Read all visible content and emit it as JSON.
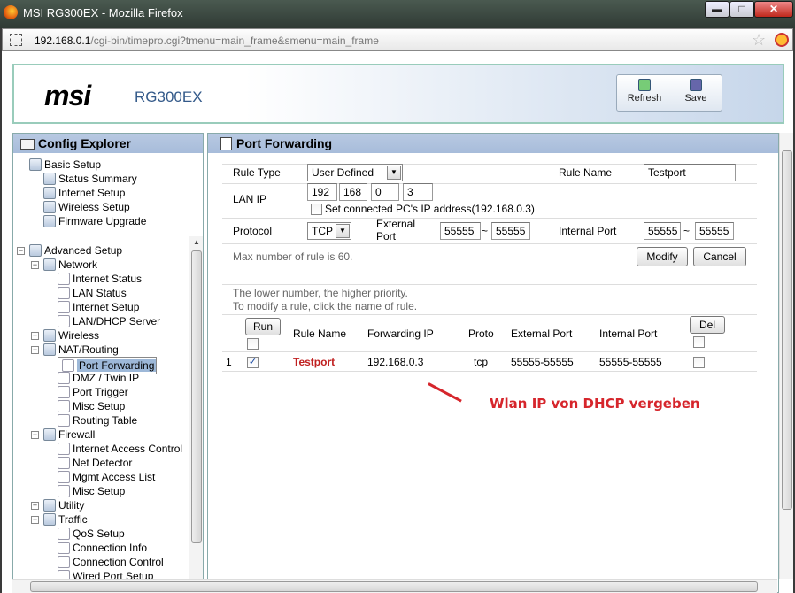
{
  "window": {
    "title": "MSI RG300EX - Mozilla Firefox",
    "min": "▬",
    "max": "□",
    "close": "✕"
  },
  "urlbar": {
    "host": "192.168.0.1",
    "path": "/cgi-bin/timepro.cgi?tmenu=main_frame&smenu=main_frame"
  },
  "header": {
    "logo": "msi",
    "model": "RG300EX",
    "refresh": "Refresh",
    "save": "Save"
  },
  "explorer": {
    "title": "Config Explorer",
    "basic": "Basic Setup",
    "status_summary": "Status Summary",
    "internet_setup": "Internet Setup",
    "wireless_setup": "Wireless Setup",
    "firmware_upgrade": "Firmware Upgrade",
    "advanced": "Advanced Setup",
    "network": "Network",
    "internet_status": "Internet Status",
    "lan_status": "LAN Status",
    "net_internet_setup": "Internet Setup",
    "lan_dhcp": "LAN/DHCP Server",
    "wireless": "Wireless",
    "nat": "NAT/Routing",
    "port_forwarding": "Port Forwarding",
    "dmz": "DMZ / Twin IP",
    "port_trigger": "Port Trigger",
    "misc_setup": "Misc Setup",
    "routing_table": "Routing Table",
    "firewall": "Firewall",
    "iac": "Internet Access Control",
    "net_detector": "Net Detector",
    "mgmt": "Mgmt Access List",
    "fw_misc": "Misc Setup",
    "utility": "Utility",
    "traffic": "Traffic",
    "qos": "QoS Setup",
    "conn_info": "Connection Info",
    "conn_control": "Connection Control",
    "wired_port": "Wired Port Setup"
  },
  "pf": {
    "title": "Port Forwarding",
    "rule_type_label": "Rule Type",
    "rule_type_value": "User Defined",
    "rule_name_label": "Rule Name",
    "rule_name_value": "Testport",
    "lan_ip_label": "LAN IP",
    "ip1": "192",
    "ip2": "168",
    "ip3": "0",
    "ip4": "3",
    "set_connected": "Set connected PC's IP address(192.168.0.3)",
    "protocol_label": "Protocol",
    "protocol_value": "TCP",
    "external_port_label": "External Port",
    "ext_from": "55555",
    "ext_to": "55555",
    "internal_port_label": "Internal Port",
    "int_from": "55555",
    "int_to": "55555",
    "tilde": "~",
    "max_rule": "Max number of rule is 60.",
    "modify": "Modify",
    "cancel": "Cancel",
    "hint1": "The lower number, the higher priority.",
    "hint2": "To modify a rule, click the name of rule."
  },
  "table": {
    "run": "Run",
    "rule_name": "Rule Name",
    "forwarding_ip": "Forwarding IP",
    "proto": "Proto",
    "external_port": "External Port",
    "internal_port": "Internal Port",
    "del": "Del",
    "rows": [
      {
        "num": "1",
        "checkmark": "✓",
        "name": "Testport",
        "ip": "192.168.0.3",
        "proto": "tcp",
        "ext": "55555-55555",
        "int": "55555-55555"
      }
    ]
  },
  "annotation": "Wlan IP von DHCP vergeben"
}
